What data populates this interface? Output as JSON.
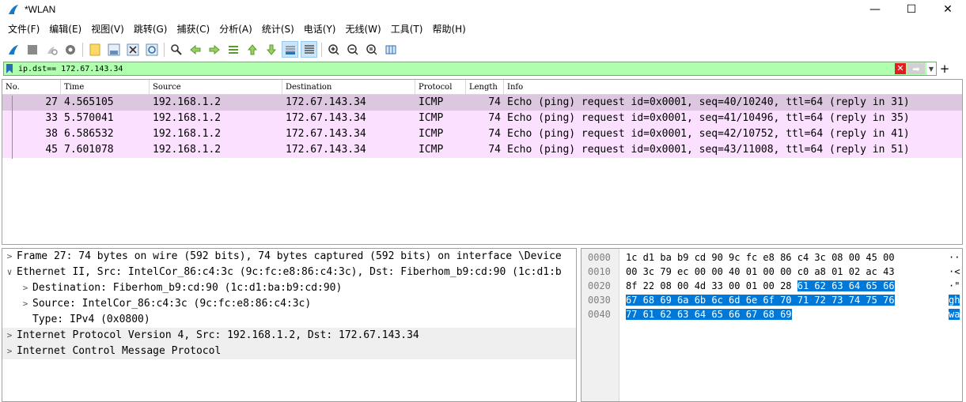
{
  "window": {
    "title": "*WLAN",
    "minimize": "—",
    "maximize": "☐",
    "close": "✕"
  },
  "menu": [
    "文件(F)",
    "编辑(E)",
    "视图(V)",
    "跳转(G)",
    "捕获(C)",
    "分析(A)",
    "统计(S)",
    "电话(Y)",
    "无线(W)",
    "工具(T)",
    "帮助(H)"
  ],
  "toolbar": {
    "icons": [
      "shark-fin-start-icon",
      "stop-square-icon",
      "restart-icon",
      "capture-options-icon",
      "open-file-icon",
      "save-file-icon",
      "close-file-icon",
      "reload-icon",
      "find-packet-icon",
      "go-back-icon",
      "go-forward-icon",
      "go-to-packet-icon",
      "first-packet-icon",
      "last-packet-icon",
      "autoscroll-icon",
      "colorize-icon",
      "zoom-in-icon",
      "zoom-out-icon",
      "normal-size-icon",
      "resize-columns-icon"
    ]
  },
  "filter": {
    "value": "ip.dst== 172.67.143.34",
    "bg_color": "#afffaf",
    "plus": "+"
  },
  "packet_list": {
    "columns": [
      "No.",
      "Time",
      "Source",
      "Destination",
      "Protocol",
      "Length",
      "Info"
    ],
    "rows": [
      {
        "no": "27",
        "time": "4.565105",
        "src": "192.168.1.2",
        "dst": "172.67.143.34",
        "proto": "ICMP",
        "len": "74",
        "info": "Echo (ping) request  id=0x0001, seq=40/10240, ttl=64 (reply in 31)"
      },
      {
        "no": "33",
        "time": "5.570041",
        "src": "192.168.1.2",
        "dst": "172.67.143.34",
        "proto": "ICMP",
        "len": "74",
        "info": "Echo (ping) request  id=0x0001, seq=41/10496, ttl=64 (reply in 35)"
      },
      {
        "no": "38",
        "time": "6.586532",
        "src": "192.168.1.2",
        "dst": "172.67.143.34",
        "proto": "ICMP",
        "len": "74",
        "info": "Echo (ping) request  id=0x0001, seq=42/10752, ttl=64 (reply in 41)"
      },
      {
        "no": "45",
        "time": "7.601078",
        "src": "192.168.1.2",
        "dst": "172.67.143.34",
        "proto": "ICMP",
        "len": "74",
        "info": "Echo (ping) request  id=0x0001, seq=43/11008, ttl=64 (reply in 51)"
      }
    ],
    "row_color": "#fce0ff",
    "selected_color": "#dcc6e0"
  },
  "details": [
    {
      "expander": ">",
      "text": "Frame 27: 74 bytes on wire (592 bits), 74 bytes captured (592 bits) on interface \\Device"
    },
    {
      "expander": "∨",
      "text": "Ethernet II, Src: IntelCor_86:c4:3c (9c:fc:e8:86:c4:3c), Dst: Fiberhom_b9:cd:90 (1c:d1:b"
    },
    {
      "expander": ">",
      "text": "Destination: Fiberhom_b9:cd:90 (1c:d1:ba:b9:cd:90)"
    },
    {
      "expander": ">",
      "text": "Source: IntelCor_86:c4:3c (9c:fc:e8:86:c4:3c)"
    },
    {
      "expander": "",
      "text": "Type: IPv4 (0x0800)"
    },
    {
      "expander": ">",
      "text": "Internet Protocol Version 4, Src: 192.168.1.2, Dst: 172.67.143.34"
    },
    {
      "expander": ">",
      "text": "Internet Control Message Protocol"
    }
  ],
  "bytes": {
    "rows": [
      {
        "offset": "0000",
        "hex_plain": "1c d1 ba b9 cd 90 9c fc  e8 86 c4 3c 08 00 45 00",
        "hex_hl": "",
        "ascii_plain": "··",
        "ascii_hl": ""
      },
      {
        "offset": "0010",
        "hex_plain": "00 3c 79 ec 00 00 40 01  00 00 c0 a8 01 02 ac 43",
        "hex_hl": "",
        "ascii_plain": "·<",
        "ascii_hl": ""
      },
      {
        "offset": "0020",
        "hex_plain": "8f 22 08 00 4d 33 00 01  00 28 ",
        "hex_hl": "61 62 63 64 65 66",
        "ascii_plain": "·\"",
        "ascii_hl": ""
      },
      {
        "offset": "0030",
        "hex_plain": "",
        "hex_hl": "67 68 69 6a 6b 6c 6d 6e  6f 70 71 72 73 74 75 76",
        "ascii_plain": "",
        "ascii_hl": "gh"
      },
      {
        "offset": "0040",
        "hex_plain": "",
        "hex_hl": "77 61 62 63 64 65 66 67  68 69",
        "ascii_plain": "",
        "ascii_hl": "wa"
      }
    ],
    "highlight_color": "#0078d7"
  }
}
